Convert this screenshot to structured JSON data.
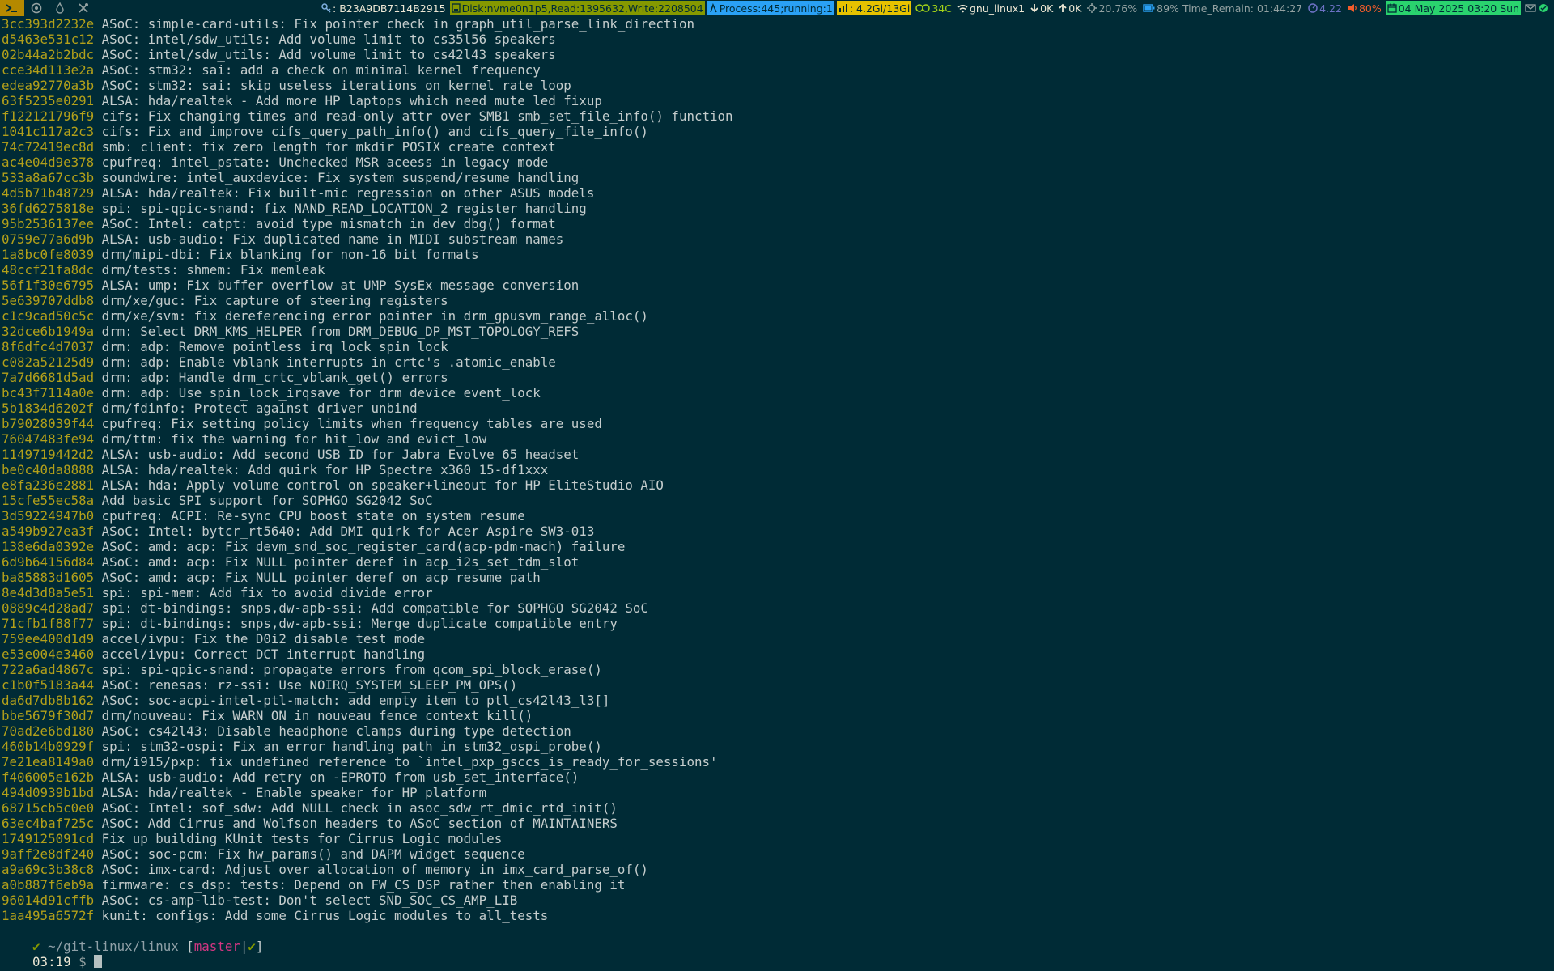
{
  "statusbar": {
    "tags": [
      {
        "icon": "terminal-icon",
        "active": true
      },
      {
        "icon": "browser-icon",
        "active": false
      },
      {
        "icon": "flame-icon",
        "active": false
      },
      {
        "icon": "tools-icon",
        "active": false
      }
    ],
    "commit_hash": ": B23A9DB7114B2915",
    "disk": "Disk:nvme0n1p5,Read:1395632,Write:2208504",
    "process": "Process:445;running:1",
    "memory": ": 4.2Gi/13Gi",
    "temperature": "34C",
    "network": "gnu_linux1",
    "download": "0K",
    "upload": "0K",
    "cpu": "20.76%",
    "battery": "89% Time_Remain: 01:44:27",
    "load": "4.22",
    "volume": "80%",
    "date": "04 May 2025 03:20 Sun",
    "colors": {
      "background": "#002b36",
      "tag_active": "#b58900",
      "disk": "#859900",
      "process": "#2aa1f5",
      "memory": "#e6c200",
      "date": "#2ad36e",
      "volume": "#f25c2b",
      "load": "#6c71c4"
    }
  },
  "terminal": {
    "commits": [
      {
        "hash": "3cc393d2232e",
        "msg": "ASoC: simple-card-utils: Fix pointer check in graph_util_parse_link_direction"
      },
      {
        "hash": "d5463e531c12",
        "msg": "ASoC: intel/sdw_utils: Add volume limit to cs35l56 speakers"
      },
      {
        "hash": "02b44a2b2bdc",
        "msg": "ASoC: intel/sdw_utils: Add volume limit to cs42l43 speakers"
      },
      {
        "hash": "cce34d113e2a",
        "msg": "ASoC: stm32: sai: add a check on minimal kernel frequency"
      },
      {
        "hash": "edea92770a3b",
        "msg": "ASoC: stm32: sai: skip useless iterations on kernel rate loop"
      },
      {
        "hash": "63f5235e0291",
        "msg": "ALSA: hda/realtek - Add more HP laptops which need mute led fixup"
      },
      {
        "hash": "f122121796f9",
        "msg": "cifs: Fix changing times and read-only attr over SMB1 smb_set_file_info() function"
      },
      {
        "hash": "1041c117a2c3",
        "msg": "cifs: Fix and improve cifs_query_path_info() and cifs_query_file_info()"
      },
      {
        "hash": "74c72419ec8d",
        "msg": "smb: client: fix zero length for mkdir POSIX create context"
      },
      {
        "hash": "ac4e04d9e378",
        "msg": "cpufreq: intel_pstate: Unchecked MSR aceess in legacy mode"
      },
      {
        "hash": "533a8a67cc3b",
        "msg": "soundwire: intel_auxdevice: Fix system suspend/resume handling"
      },
      {
        "hash": "4d5b71b48729",
        "msg": "ALSA: hda/realtek: Fix built-mic regression on other ASUS models"
      },
      {
        "hash": "36fd6275818e",
        "msg": "spi: spi-qpic-snand: fix NAND_READ_LOCATION_2 register handling"
      },
      {
        "hash": "95b2536137ee",
        "msg": "ASoC: Intel: catpt: avoid type mismatch in dev_dbg() format"
      },
      {
        "hash": "0759e77a6d9b",
        "msg": "ALSA: usb-audio: Fix duplicated name in MIDI substream names"
      },
      {
        "hash": "1a8bc0fe8039",
        "msg": "drm/mipi-dbi: Fix blanking for non-16 bit formats"
      },
      {
        "hash": "48ccf21fa8dc",
        "msg": "drm/tests: shmem: Fix memleak"
      },
      {
        "hash": "56f1f30e6795",
        "msg": "ALSA: ump: Fix buffer overflow at UMP SysEx message conversion"
      },
      {
        "hash": "5e639707ddb8",
        "msg": "drm/xe/guc: Fix capture of steering registers"
      },
      {
        "hash": "c1c9cad50c5c",
        "msg": "drm/xe/svm: fix dereferencing error pointer in drm_gpusvm_range_alloc()"
      },
      {
        "hash": "32dce6b1949a",
        "msg": "drm: Select DRM_KMS_HELPER from DRM_DEBUG_DP_MST_TOPOLOGY_REFS"
      },
      {
        "hash": "8f6dfc4d7037",
        "msg": "drm: adp: Remove pointless irq_lock spin lock"
      },
      {
        "hash": "c082a52125d9",
        "msg": "drm: adp: Enable vblank interrupts in crtc's .atomic_enable"
      },
      {
        "hash": "7a7d6681d5ad",
        "msg": "drm: adp: Handle drm_crtc_vblank_get() errors"
      },
      {
        "hash": "bc43f7114a0e",
        "msg": "drm: adp: Use spin_lock_irqsave for drm device event_lock"
      },
      {
        "hash": "5b1834d6202f",
        "msg": "drm/fdinfo: Protect against driver unbind"
      },
      {
        "hash": "b79028039f44",
        "msg": "cpufreq: Fix setting policy limits when frequency tables are used"
      },
      {
        "hash": "76047483fe94",
        "msg": "drm/ttm: fix the warning for hit_low and evict_low"
      },
      {
        "hash": "1149719442d2",
        "msg": "ALSA: usb-audio: Add second USB ID for Jabra Evolve 65 headset"
      },
      {
        "hash": "be0c40da8888",
        "msg": "ALSA: hda/realtek: Add quirk for HP Spectre x360 15-df1xxx"
      },
      {
        "hash": "e8fa236e2881",
        "msg": "ALSA: hda: Apply volume control on speaker+lineout for HP EliteStudio AIO"
      },
      {
        "hash": "15cfe55ec58a",
        "msg": "Add basic SPI support for SOPHGO SG2042 SoC"
      },
      {
        "hash": "3d59224947b0",
        "msg": "cpufreq: ACPI: Re-sync CPU boost state on system resume"
      },
      {
        "hash": "a549b927ea3f",
        "msg": "ASoC: Intel: bytcr_rt5640: Add DMI quirk for Acer Aspire SW3-013"
      },
      {
        "hash": "138e6da0392e",
        "msg": "ASoC: amd: acp: Fix devm_snd_soc_register_card(acp-pdm-mach) failure"
      },
      {
        "hash": "6d9b64156d84",
        "msg": "ASoC: amd: acp: Fix NULL pointer deref in acp_i2s_set_tdm_slot"
      },
      {
        "hash": "ba85883d1605",
        "msg": "ASoC: amd: acp: Fix NULL pointer deref on acp resume path"
      },
      {
        "hash": "8e4d3d8a5e51",
        "msg": "spi: spi-mem: Add fix to avoid divide error"
      },
      {
        "hash": "0889c4d28ad7",
        "msg": "spi: dt-bindings: snps,dw-apb-ssi: Add compatible for SOPHGO SG2042 SoC"
      },
      {
        "hash": "71cfb1f88f77",
        "msg": "spi: dt-bindings: snps,dw-apb-ssi: Merge duplicate compatible entry"
      },
      {
        "hash": "759ee400d1d9",
        "msg": "accel/ivpu: Fix the D0i2 disable test mode"
      },
      {
        "hash": "e53e004e3460",
        "msg": "accel/ivpu: Correct DCT interrupt handling"
      },
      {
        "hash": "722a6ad4867c",
        "msg": "spi: spi-qpic-snand: propagate errors from qcom_spi_block_erase()"
      },
      {
        "hash": "c1b0f5183a44",
        "msg": "ASoC: renesas: rz-ssi: Use NOIRQ_SYSTEM_SLEEP_PM_OPS()"
      },
      {
        "hash": "da6d7db8b162",
        "msg": "ASoC: soc-acpi-intel-ptl-match: add empty item to ptl_cs42l43_l3[]"
      },
      {
        "hash": "bbe5679f30d7",
        "msg": "drm/nouveau: Fix WARN_ON in nouveau_fence_context_kill()"
      },
      {
        "hash": "70ad2e6bd180",
        "msg": "ASoC: cs42l43: Disable headphone clamps during type detection"
      },
      {
        "hash": "460b14b0929f",
        "msg": "spi: stm32-ospi: Fix an error handling path in stm32_ospi_probe()"
      },
      {
        "hash": "7e21ea8149a0",
        "msg": "drm/i915/pxp: fix undefined reference to `intel_pxp_gsccs_is_ready_for_sessions'"
      },
      {
        "hash": "f406005e162b",
        "msg": "ALSA: usb-audio: Add retry on -EPROTO from usb_set_interface()"
      },
      {
        "hash": "494d0939b1bd",
        "msg": "ALSA: hda/realtek - Enable speaker for HP platform"
      },
      {
        "hash": "68715cb5c0e0",
        "msg": "ASoC: Intel: sof_sdw: Add NULL check in asoc_sdw_rt_dmic_rtd_init()"
      },
      {
        "hash": "63ec4baf725c",
        "msg": "ASoC: Add Cirrus and Wolfson headers to ASoC section of MAINTAINERS"
      },
      {
        "hash": "1749125091cd",
        "msg": "Fix up building KUnit tests for Cirrus Logic modules"
      },
      {
        "hash": "9aff2e8df240",
        "msg": "ASoC: soc-pcm: Fix hw_params() and DAPM widget sequence"
      },
      {
        "hash": "a9a69c3b38c8",
        "msg": "ASoC: imx-card: Adjust over allocation of memory in imx_card_parse_of()"
      },
      {
        "hash": "a0b887f6eb9a",
        "msg": "firmware: cs_dsp: tests: Depend on FW_CS_DSP rather then enabling it"
      },
      {
        "hash": "96014d91cffb",
        "msg": "ASoC: cs-amp-lib-test: Don't select SND_SOC_CS_AMP_LIB"
      },
      {
        "hash": "1aa495a6572f",
        "msg": "kunit: configs: Add some Cirrus Logic modules to all_tests"
      }
    ],
    "prompt": {
      "check": "✔",
      "cwd": " ~/git-linux/linux ",
      "bracket_open": "[",
      "branch": "master",
      "separator": "|",
      "status": "✔",
      "bracket_close": "]"
    },
    "input_line": {
      "time": "03:19",
      "sign": " $ "
    }
  }
}
